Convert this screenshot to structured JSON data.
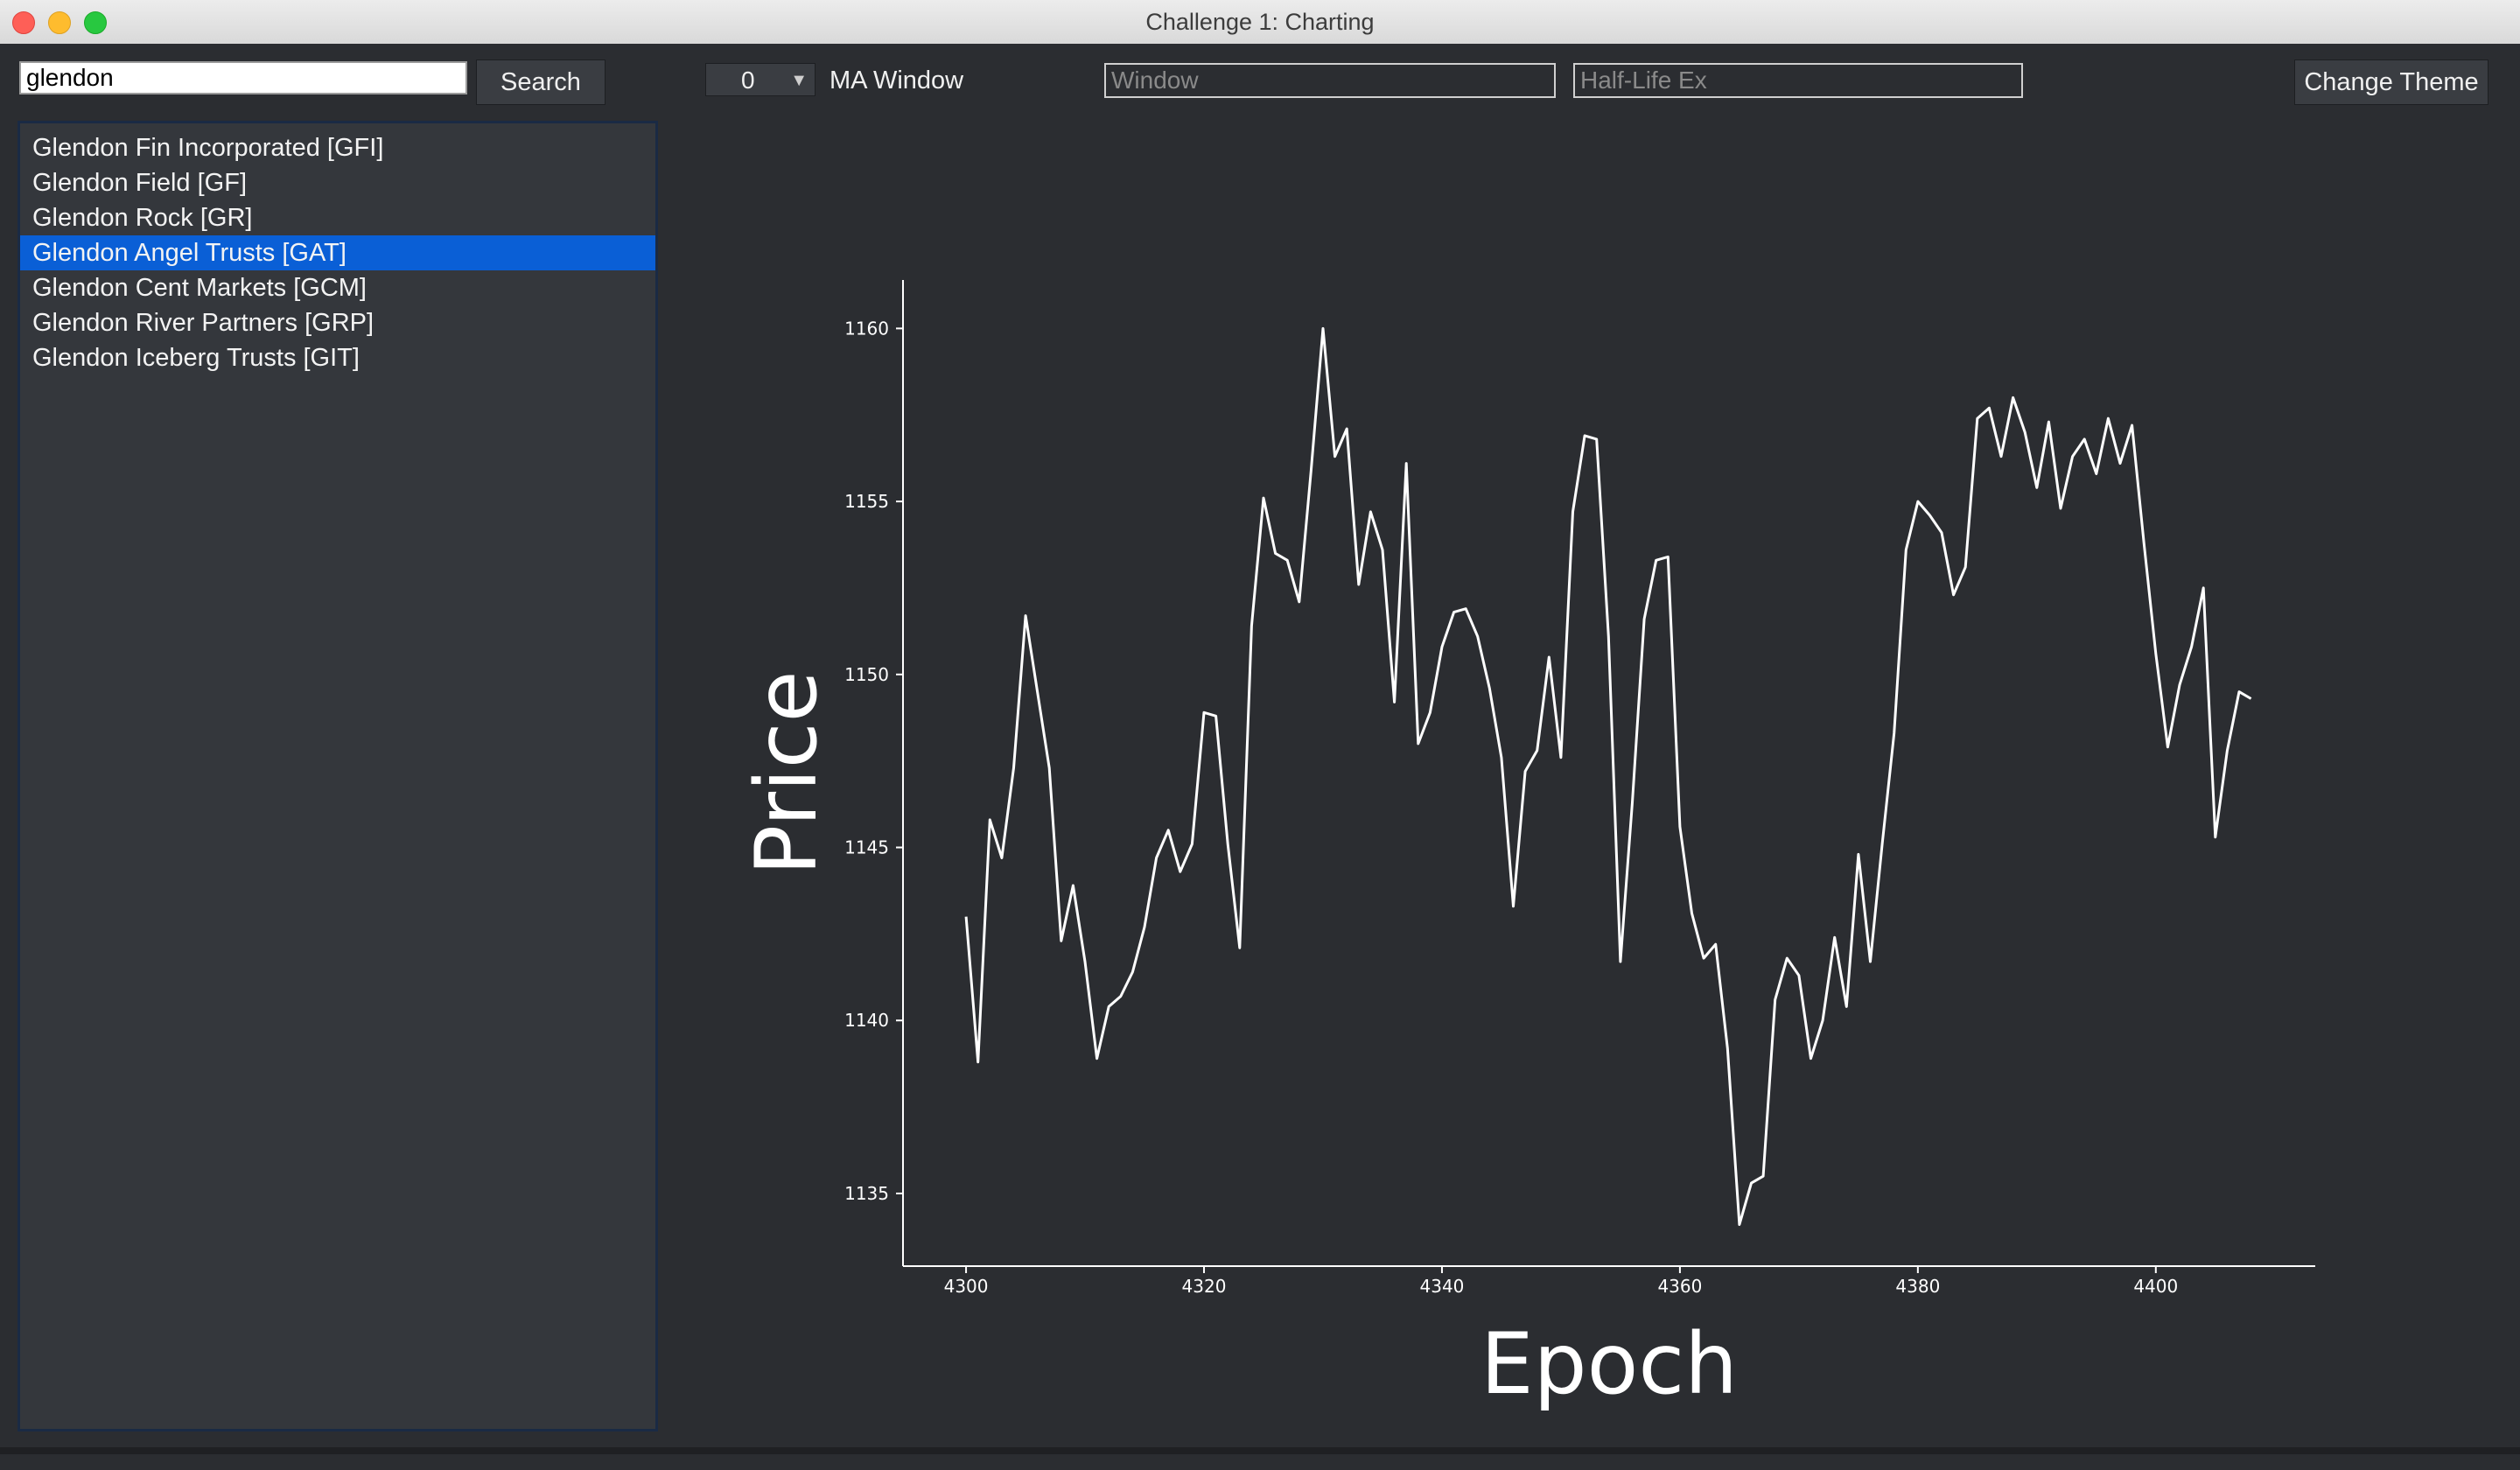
{
  "window": {
    "title": "Challenge 1: Charting"
  },
  "toolbar": {
    "search_value": "glendon",
    "search_button": "Search",
    "ma_window_value": "0",
    "ma_window_label": "MA Window",
    "window_placeholder": "Window",
    "halflife_placeholder": "Half-Life Ex",
    "change_theme_button": "Change Theme"
  },
  "results": {
    "selected_index": 3,
    "items": [
      {
        "label": "Glendon Fin Incorporated [GFI]"
      },
      {
        "label": "Glendon Field [GF]"
      },
      {
        "label": "Glendon Rock [GR]"
      },
      {
        "label": "Glendon Angel Trusts [GAT]"
      },
      {
        "label": "Glendon Cent Markets [GCM]"
      },
      {
        "label": "Glendon River Partners [GRP]"
      },
      {
        "label": "Glendon Iceberg Trusts [GIT]"
      }
    ]
  },
  "colors": {
    "selection": "#0a5fd6",
    "background": "#2b2d31",
    "line": "#ffffff"
  },
  "chart_data": {
    "type": "line",
    "xlabel": "Epoch",
    "ylabel": "Price",
    "title": "",
    "xlim": [
      4294.7,
      4413.4
    ],
    "ylim": [
      1132.9,
      1161.4
    ],
    "xticks": [
      4300,
      4320,
      4340,
      4360,
      4380,
      4400
    ],
    "yticks": [
      1135,
      1140,
      1145,
      1150,
      1155,
      1160
    ],
    "grid": false,
    "series": [
      {
        "x": [
          4300,
          4301,
          4302,
          4303,
          4304,
          4305,
          4306,
          4307,
          4308,
          4309,
          4310,
          4311,
          4312,
          4313,
          4314,
          4315,
          4316,
          4317,
          4318,
          4319,
          4320,
          4321,
          4322,
          4323,
          4324,
          4325,
          4326,
          4327,
          4328,
          4329,
          4330,
          4331,
          4332,
          4333,
          4334,
          4335,
          4336,
          4337,
          4338,
          4339,
          4340,
          4341,
          4342,
          4343,
          4344,
          4345,
          4346,
          4347,
          4348,
          4349,
          4350,
          4351,
          4352,
          4353,
          4354,
          4355,
          4356,
          4357,
          4358,
          4359,
          4360,
          4361,
          4362,
          4363,
          4364,
          4365,
          4366,
          4367,
          4368,
          4369,
          4370,
          4371,
          4372,
          4373,
          4374,
          4375,
          4376,
          4377,
          4378,
          4379,
          4380,
          4381,
          4382,
          4383,
          4384,
          4385,
          4386,
          4387,
          4388,
          4389,
          4390,
          4391,
          4392,
          4393,
          4394,
          4395,
          4396,
          4397,
          4398,
          4399,
          4400,
          4401,
          4402,
          4403,
          4404,
          4405,
          4406,
          4407,
          4408
        ],
        "y": [
          1143.0,
          1138.8,
          1145.8,
          1144.7,
          1147.3,
          1151.7,
          1149.5,
          1147.3,
          1142.3,
          1143.9,
          1141.7,
          1138.9,
          1140.4,
          1140.7,
          1141.4,
          1142.7,
          1144.7,
          1145.5,
          1144.3,
          1145.1,
          1148.9,
          1148.8,
          1145.1,
          1142.1,
          1151.4,
          1155.1,
          1153.5,
          1153.3,
          1152.1,
          1155.9,
          1160.0,
          1156.3,
          1157.1,
          1152.6,
          1154.7,
          1153.6,
          1149.2,
          1156.1,
          1148.0,
          1148.9,
          1150.8,
          1151.8,
          1151.9,
          1151.1,
          1149.6,
          1147.6,
          1143.3,
          1147.2,
          1147.8,
          1150.5,
          1147.6,
          1154.7,
          1156.9,
          1156.8,
          1151.1,
          1141.7,
          1146.3,
          1151.6,
          1153.3,
          1153.4,
          1145.6,
          1143.1,
          1141.8,
          1142.2,
          1139.2,
          1134.1,
          1135.3,
          1135.5,
          1140.6,
          1141.8,
          1141.3,
          1138.9,
          1140.0,
          1142.4,
          1140.4,
          1144.8,
          1141.7,
          1145.1,
          1148.3,
          1153.6,
          1155.0,
          1154.6,
          1154.1,
          1152.3,
          1153.1,
          1157.4,
          1157.7,
          1156.3,
          1158.0,
          1157.0,
          1155.4,
          1157.3,
          1154.8,
          1156.3,
          1156.8,
          1155.8,
          1157.4,
          1156.1,
          1157.2,
          1153.8,
          1150.6,
          1147.9,
          1149.7,
          1150.8,
          1152.5,
          1145.3,
          1147.8,
          1149.5,
          1149.3
        ]
      }
    ]
  }
}
